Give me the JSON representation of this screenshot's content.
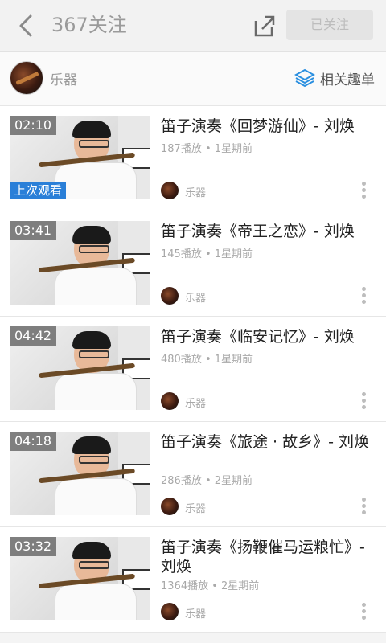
{
  "header": {
    "title": "367关注",
    "follow_label": "已关注"
  },
  "channel": {
    "name": "乐器",
    "related_label": "相关趣单"
  },
  "accent_color": "#2a7fd8",
  "videos": [
    {
      "duration": "02:10",
      "title": "笛子演奏《回梦游仙》- 刘焕",
      "meta": "187播放 • 1星期前",
      "uploader": "乐器",
      "badge": "上次观看"
    },
    {
      "duration": "03:41",
      "title": "笛子演奏《帝王之恋》- 刘焕",
      "meta": "145播放 • 1星期前",
      "uploader": "乐器"
    },
    {
      "duration": "04:42",
      "title": "笛子演奏《临安记忆》- 刘焕",
      "meta": "480播放 • 1星期前",
      "uploader": "乐器"
    },
    {
      "duration": "04:18",
      "title": "笛子演奏《旅途 · 故乡》- 刘焕",
      "meta": "286播放 • 2星期前",
      "uploader": "乐器"
    },
    {
      "duration": "03:32",
      "title": "笛子演奏《扬鞭催马运粮忙》- 刘焕",
      "meta": "1364播放 • 2星期前",
      "uploader": "乐器"
    }
  ]
}
